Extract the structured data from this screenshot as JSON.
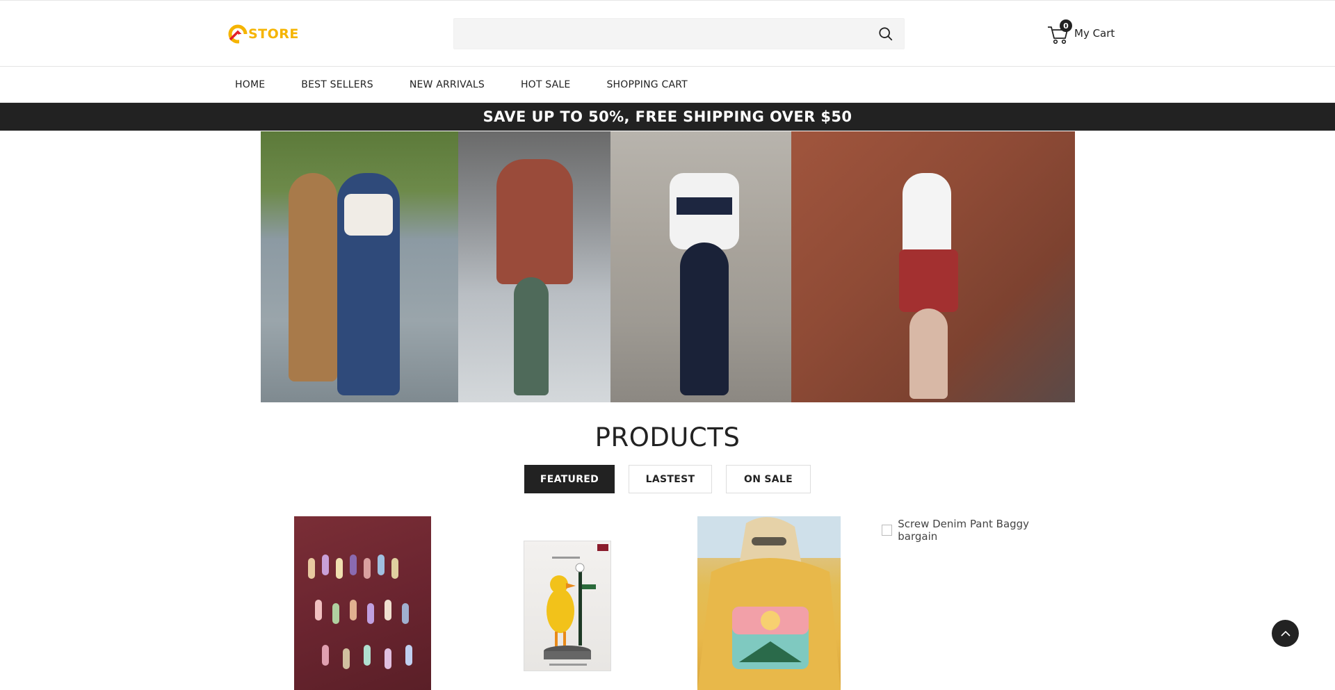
{
  "logo": {
    "text": "STORE",
    "color": "#f5b400"
  },
  "search": {
    "placeholder": "",
    "icon": "search-icon"
  },
  "cart": {
    "count": "0",
    "label": "My Cart",
    "icon": "cart-icon"
  },
  "nav": {
    "items": [
      "HOME",
      "BEST SELLERS",
      "NEW ARRIVALS",
      "HOT SALE",
      "SHOPPING CART"
    ]
  },
  "promo": {
    "text": "SAVE UP TO 50%, FREE SHIPPING OVER $50"
  },
  "products": {
    "title": "PRODUCTS",
    "tabs": [
      "FEATURED",
      "LASTEST",
      "ON SALE"
    ],
    "active_tab": "FEATURED",
    "items": [
      {
        "alt": ""
      },
      {
        "alt": ""
      },
      {
        "alt": ""
      },
      {
        "alt": "Screw Denim Pant Baggy bargain"
      }
    ]
  },
  "colors": {
    "dark": "#222222",
    "accent": "#f5b400"
  }
}
